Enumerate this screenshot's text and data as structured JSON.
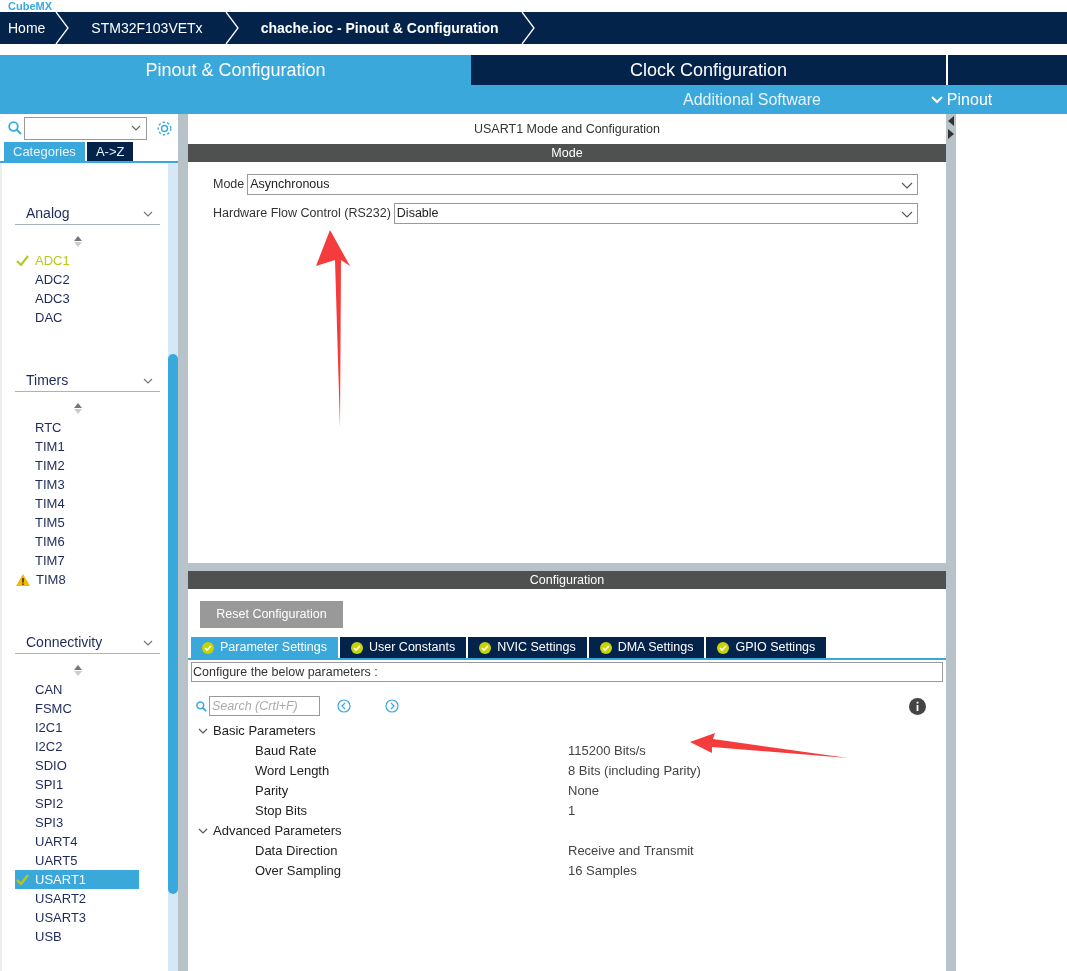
{
  "app_title": "CubeMX",
  "breadcrumb": [
    {
      "label": "Home",
      "current": false
    },
    {
      "label": "STM32F103VETx",
      "current": false
    },
    {
      "label": "chache.ioc - Pinout & Configuration",
      "current": true
    }
  ],
  "main_tabs": [
    {
      "label": "Pinout & Configuration",
      "selected": true
    },
    {
      "label": "Clock Configuration",
      "selected": false
    }
  ],
  "sub_toolbar": {
    "additional_software": "Additional Software",
    "pinout_menu": "Pinout"
  },
  "sidebar": {
    "tabs": [
      {
        "label": "Categories",
        "selected": true
      },
      {
        "label": "A->Z",
        "selected": false
      }
    ],
    "sections": [
      {
        "title": "Analog",
        "expanded": true,
        "items": [
          {
            "label": "ADC1",
            "kind": "configured",
            "selected": false
          },
          {
            "label": "ADC2",
            "kind": "plain",
            "selected": false
          },
          {
            "label": "ADC3",
            "kind": "plain",
            "selected": false
          },
          {
            "label": "DAC",
            "kind": "plain",
            "selected": false
          }
        ]
      },
      {
        "title": "Timers",
        "expanded": true,
        "items": [
          {
            "label": "RTC",
            "kind": "plain",
            "selected": false
          },
          {
            "label": "TIM1",
            "kind": "plain",
            "selected": false
          },
          {
            "label": "TIM2",
            "kind": "plain",
            "selected": false
          },
          {
            "label": "TIM3",
            "kind": "plain",
            "selected": false
          },
          {
            "label": "TIM4",
            "kind": "plain",
            "selected": false
          },
          {
            "label": "TIM5",
            "kind": "plain",
            "selected": false
          },
          {
            "label": "TIM6",
            "kind": "plain",
            "selected": false
          },
          {
            "label": "TIM7",
            "kind": "plain",
            "selected": false
          },
          {
            "label": "TIM8",
            "kind": "warning",
            "selected": false
          }
        ]
      },
      {
        "title": "Connectivity",
        "expanded": true,
        "items": [
          {
            "label": "CAN",
            "kind": "plain",
            "selected": false
          },
          {
            "label": "FSMC",
            "kind": "plain",
            "selected": false
          },
          {
            "label": "I2C1",
            "kind": "plain",
            "selected": false
          },
          {
            "label": "I2C2",
            "kind": "plain",
            "selected": false
          },
          {
            "label": "SDIO",
            "kind": "plain",
            "selected": false
          },
          {
            "label": "SPI1",
            "kind": "plain",
            "selected": false
          },
          {
            "label": "SPI2",
            "kind": "plain",
            "selected": false
          },
          {
            "label": "SPI3",
            "kind": "plain",
            "selected": false
          },
          {
            "label": "UART4",
            "kind": "plain",
            "selected": false
          },
          {
            "label": "UART5",
            "kind": "plain",
            "selected": false
          },
          {
            "label": "USART1",
            "kind": "configured",
            "selected": true
          },
          {
            "label": "USART2",
            "kind": "plain",
            "selected": false
          },
          {
            "label": "USART3",
            "kind": "plain",
            "selected": false
          },
          {
            "label": "USB",
            "kind": "plain",
            "selected": false
          }
        ]
      }
    ]
  },
  "mode_panel": {
    "title": "USART1 Mode and Configuration",
    "header": "Mode",
    "fields": [
      {
        "label": "Mode",
        "value": "Asynchronous"
      },
      {
        "label": "Hardware Flow Control (RS232)",
        "value": "Disable"
      }
    ]
  },
  "config_panel": {
    "header": "Configuration",
    "reset_button": "Reset Configuration",
    "tabs": [
      {
        "label": "Parameter Settings",
        "selected": true
      },
      {
        "label": "User Constants",
        "selected": false
      },
      {
        "label": "NVIC Settings",
        "selected": false
      },
      {
        "label": "DMA Settings",
        "selected": false
      },
      {
        "label": "GPIO Settings",
        "selected": false
      }
    ],
    "description": "Configure the below parameters :",
    "search_placeholder": "Search (Crtl+F)",
    "groups": [
      {
        "title": "Basic Parameters",
        "expanded": true,
        "params": [
          {
            "name": "Baud Rate",
            "value": "115200 Bits/s"
          },
          {
            "name": "Word Length",
            "value": "8 Bits (including Parity)"
          },
          {
            "name": "Parity",
            "value": "None"
          },
          {
            "name": "Stop Bits",
            "value": "1"
          }
        ]
      },
      {
        "title": "Advanced Parameters",
        "expanded": true,
        "params": [
          {
            "name": "Data Direction",
            "value": "Receive and Transmit"
          },
          {
            "name": "Over Sampling",
            "value": "16 Samples"
          }
        ]
      }
    ]
  }
}
